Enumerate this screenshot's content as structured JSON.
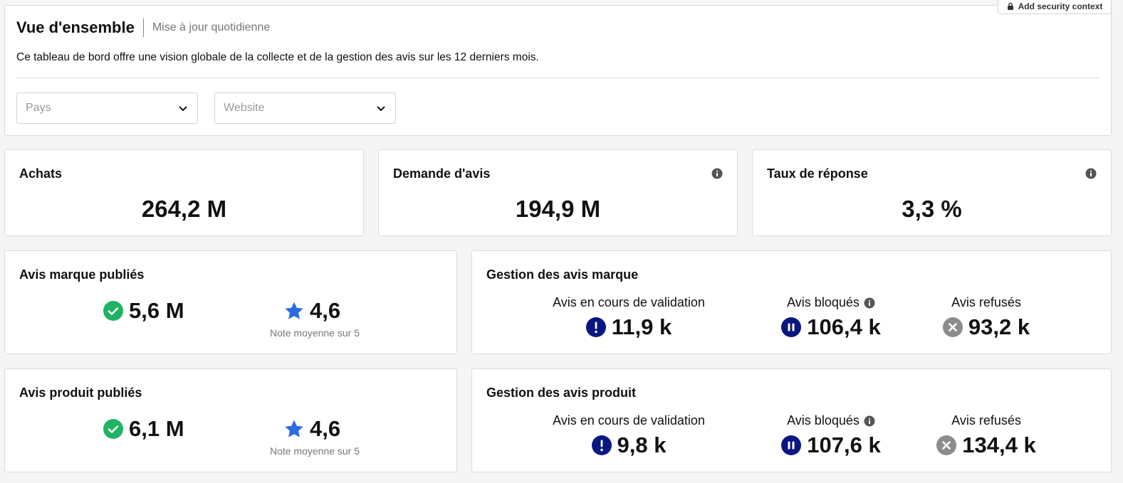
{
  "header": {
    "title": "Vue d'ensemble",
    "subtitle": "Mise à jour quotidienne",
    "description": "Ce tableau de bord offre une vision globale de la collecte et de la gestion des avis sur les 12 derniers mois.",
    "security_button": "Add security context",
    "filters": [
      {
        "placeholder": "Pays"
      },
      {
        "placeholder": "Website"
      }
    ]
  },
  "kpis": [
    {
      "title": "Achats",
      "value": "264,2 M"
    },
    {
      "title": "Demande d'avis",
      "value": "194,9 M"
    },
    {
      "title": "Taux de réponse",
      "value": "3,3 %"
    }
  ],
  "published": {
    "marque": {
      "title": "Avis marque publiés",
      "count": "5,6 M",
      "rating": "4,6",
      "rating_caption": "Note moyenne sur 5"
    },
    "produit": {
      "title": "Avis produit publiés",
      "count": "6,1 M",
      "rating": "4,6",
      "rating_caption": "Note moyenne sur 5"
    }
  },
  "gestion": {
    "marque": {
      "title": "Gestion des avis marque",
      "validation_label": "Avis en cours de validation",
      "validation_value": "11,9 k",
      "blocked_label": "Avis bloqués",
      "blocked_value": "106,4 k",
      "refused_label": "Avis refusés",
      "refused_value": "93,2 k"
    },
    "produit": {
      "title": "Gestion des avis produit",
      "validation_label": "Avis en cours de validation",
      "validation_value": "9,8 k",
      "blocked_label": "Avis bloqués",
      "blocked_value": "107,6 k",
      "refused_label": "Avis refusés",
      "refused_value": "134,4 k"
    }
  },
  "colors": {
    "success": "#1fb463",
    "star": "#2b6de0",
    "pending": "#0b1780",
    "refused": "#8c8c8c",
    "info": "#555555"
  },
  "icons": [
    "lock-icon",
    "chevron-down-icon",
    "info-icon",
    "check-circle-icon",
    "star-icon",
    "exclamation-circle-icon",
    "pause-circle-icon",
    "x-circle-icon"
  ]
}
